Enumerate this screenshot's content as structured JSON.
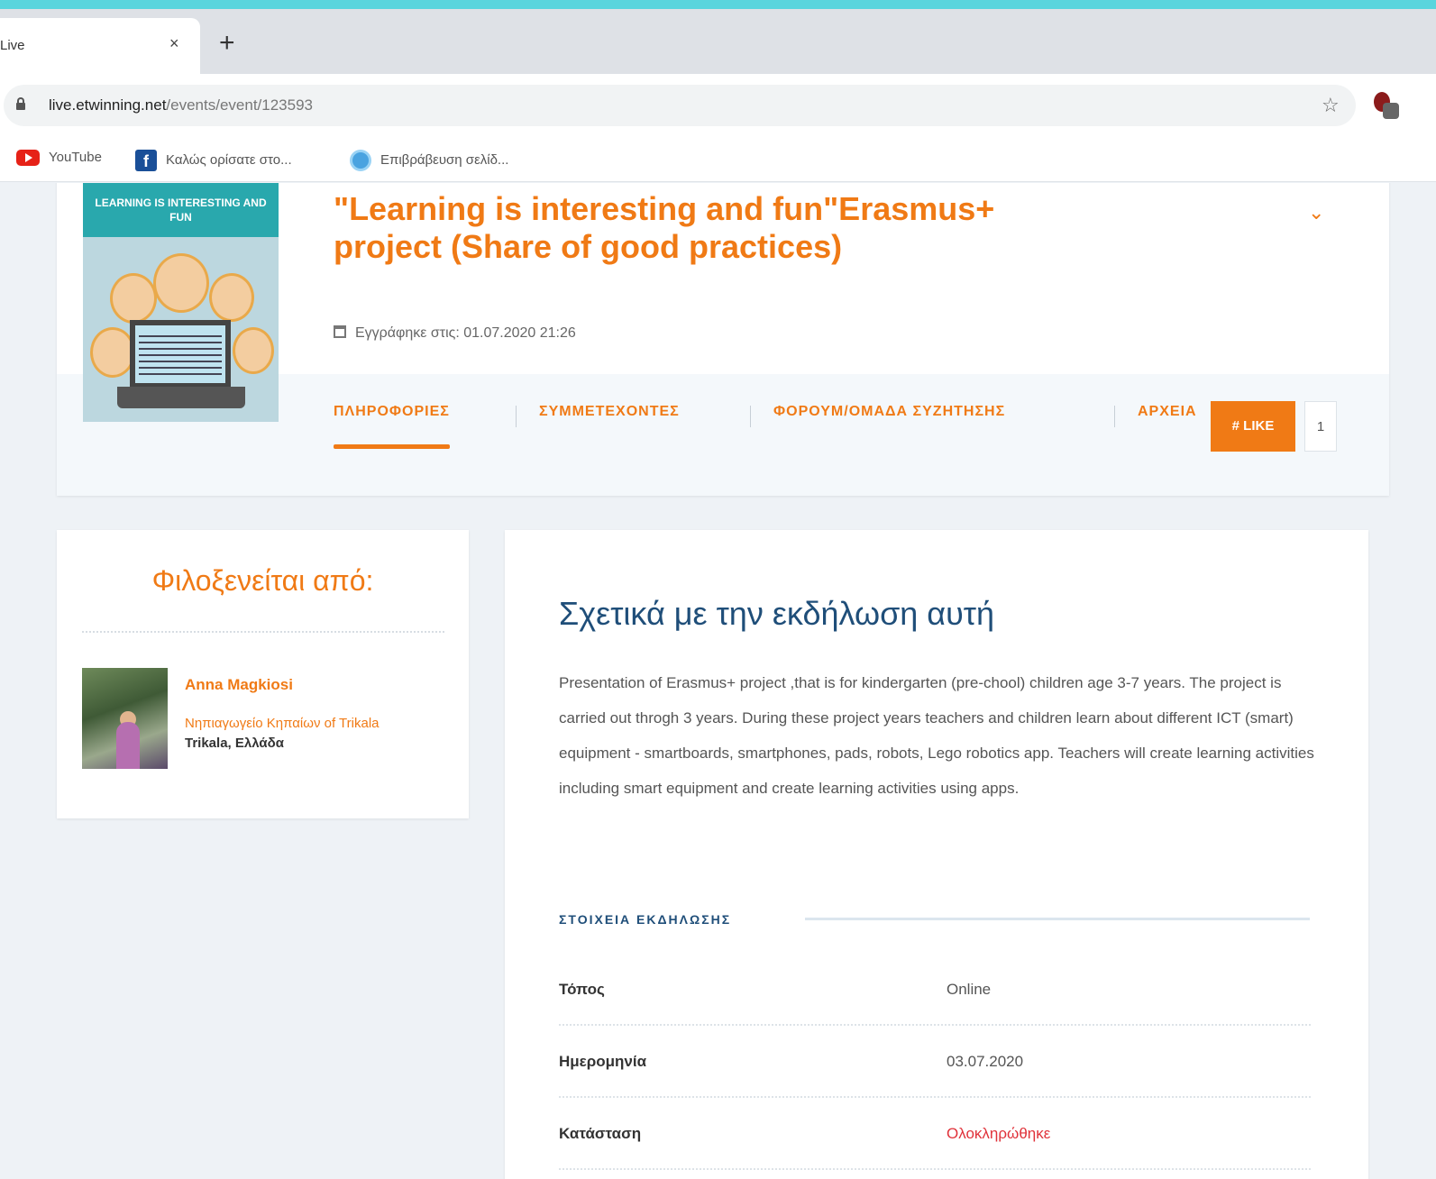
{
  "browser": {
    "tab_title": "Live",
    "tab_close": "×",
    "new_tab": "+",
    "url_domain": "live.etwinning.net",
    "url_path": "/events/event/123593",
    "bookmarks": [
      {
        "label": "YouTube",
        "icon": "youtube-icon"
      },
      {
        "label": "Καλώς ορίσατε στο...",
        "icon": "facebook-icon"
      },
      {
        "label": "Επιβράβευση σελίδ...",
        "icon": "globe-icon"
      }
    ]
  },
  "event": {
    "title": "\"Learning is interesting and fun\"Erasmus+ project (Share of good practices)",
    "thumbnail_banner": "LEARNING IS INTERESTING AND FUN",
    "registered": "Εγγράφηκε στις: 01.07.2020 21:26",
    "chevron": "⌄",
    "tabs": [
      {
        "label": "ΠΛΗΡΟΦΟΡΙΕΣ"
      },
      {
        "label": "ΣΥΜΜΕΤΕΧΟΝΤΕΣ"
      },
      {
        "label": "ΦΟΡΟΥΜ/ΟΜΑΔΑ ΣΥΖΗΤΗΣΗΣ"
      },
      {
        "label": "ΑΡΧΕΙΑ"
      }
    ],
    "like_label": "# LIKE",
    "like_count": "1"
  },
  "host": {
    "heading": "Φιλοξενείται από:",
    "name": "Anna Magkiosi",
    "school": "Νηπιαγωγείο Κηπαίων of Trikala",
    "location": "Trikala, Ελλάδα"
  },
  "about": {
    "heading": "Σχετικά με την εκδήλωση αυτή",
    "description": "Presentation of Erasmus+ project ,that is for kindergarten (pre-chool) children age 3-7 years. The project is carried out throgh 3 years. During these project years teachers and children learn about different ICT (smart) equipment - smartboards, smartphones, pads, robots, Lego robotics app. Teachers will create learning activities including smart equipment and create learning activities using apps.",
    "details_heading": "ΣΤΟΙΧΕΙΑ ΕΚΔΗΛΩΣΗΣ",
    "details": [
      {
        "key": "Τόπος",
        "value": "Online"
      },
      {
        "key": "Ημερομηνία",
        "value": "03.07.2020"
      },
      {
        "key": "Κατάσταση",
        "value": "Ολοκληρώθηκε"
      }
    ]
  },
  "colors": {
    "accent": "#f07a15",
    "heading_blue": "#1f4e79",
    "status_red": "#e0323a",
    "top_bar": "#5ad5dd"
  }
}
